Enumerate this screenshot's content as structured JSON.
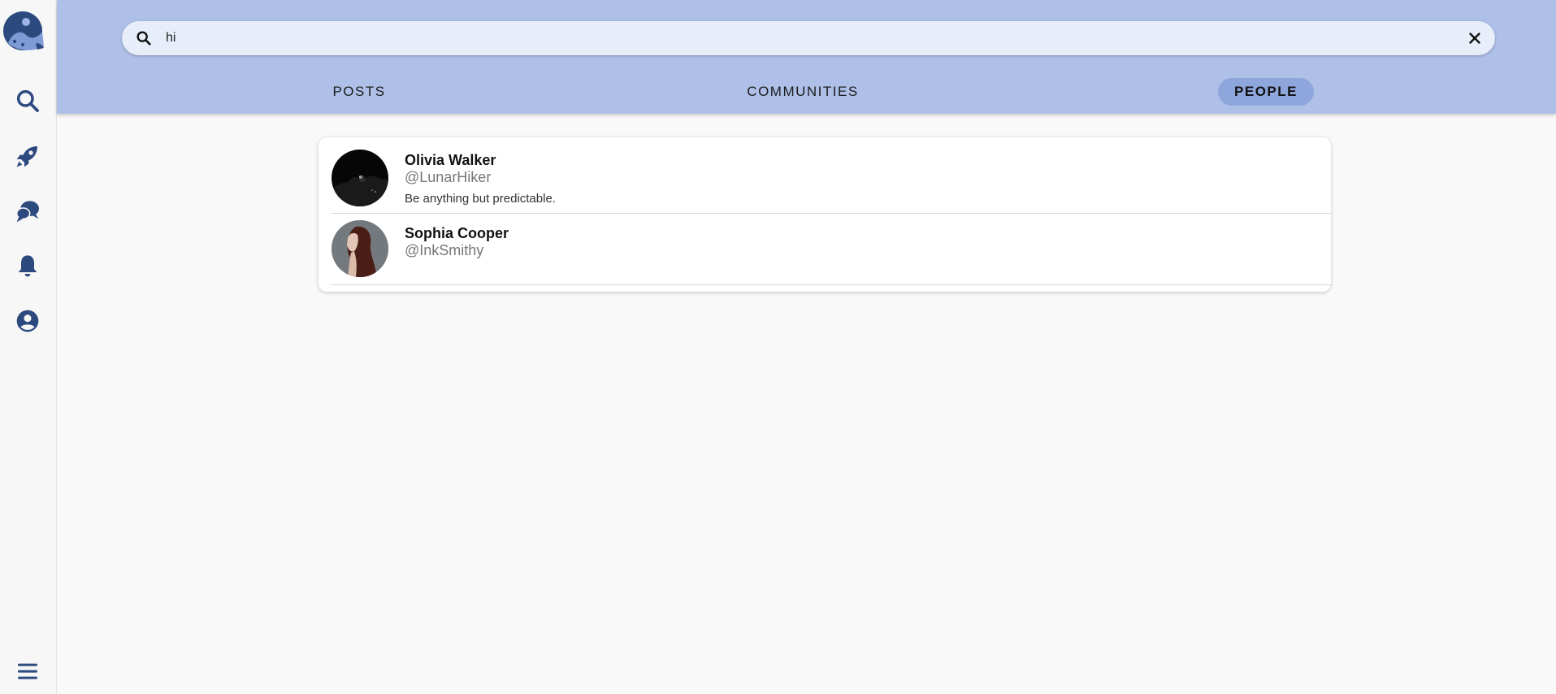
{
  "sidebar": {
    "logo": "app-logo",
    "items": [
      {
        "icon": "search-icon"
      },
      {
        "icon": "rocket-icon"
      },
      {
        "icon": "chat-bubbles-icon"
      },
      {
        "icon": "bell-icon"
      },
      {
        "icon": "account-icon"
      }
    ],
    "menu_icon": "hamburger-menu-icon"
  },
  "search": {
    "value": "hi",
    "placeholder": ""
  },
  "tabs": [
    {
      "label": "POSTS",
      "active": false
    },
    {
      "label": "COMMUNITIES",
      "active": false
    },
    {
      "label": "PEOPLE",
      "active": true
    }
  ],
  "people": [
    {
      "name": "Olivia Walker",
      "handle": "@LunarHiker",
      "bio": "Be anything but predictable."
    },
    {
      "name": "Sophia Cooper",
      "handle": "@InkSmithy",
      "bio": ""
    }
  ],
  "colors": {
    "topbar": "#aec0e8",
    "active_tab": "#8fa6dc",
    "icon": "#2c4a7e"
  }
}
